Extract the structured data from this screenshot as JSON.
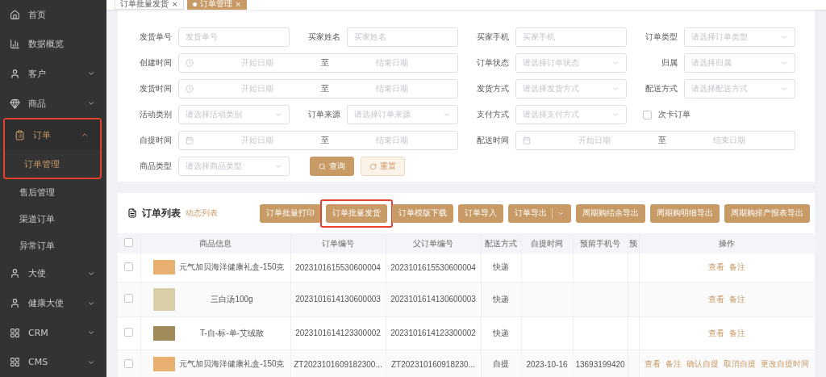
{
  "sidebar": {
    "items": [
      {
        "label": "首页",
        "expandable": false,
        "selected": false,
        "highlighted": false
      },
      {
        "label": "数据概览",
        "expandable": false,
        "selected": false,
        "highlighted": false
      },
      {
        "label": "客户",
        "expandable": true,
        "expanded": false,
        "selected": false,
        "highlighted": false
      },
      {
        "label": "商品",
        "expandable": true,
        "expanded": false,
        "selected": false,
        "highlighted": false
      },
      {
        "label": "订单",
        "expandable": true,
        "expanded": true,
        "selected": true,
        "highlighted": true,
        "children": [
          {
            "label": "订单管理",
            "selected": true,
            "highlighted": true
          },
          {
            "label": "售后管理",
            "selected": false,
            "highlighted": false
          },
          {
            "label": "渠道订单",
            "selected": false,
            "highlighted": false
          },
          {
            "label": "异常订单",
            "selected": false,
            "highlighted": false
          }
        ]
      },
      {
        "label": "大使",
        "expandable": true,
        "expanded": false,
        "selected": false,
        "highlighted": false
      },
      {
        "label": "健康大使",
        "expandable": true,
        "expanded": false,
        "selected": false,
        "highlighted": false
      },
      {
        "label": "CRM",
        "expandable": true,
        "expanded": false,
        "selected": false,
        "highlighted": false
      },
      {
        "label": "CMS",
        "expandable": true,
        "expanded": false,
        "selected": false,
        "highlighted": false
      }
    ]
  },
  "tabs": [
    {
      "label": "订单批量发货",
      "close": "×",
      "selected": false
    },
    {
      "label": "订单管理",
      "close": "×",
      "selected": true
    }
  ],
  "filters": {
    "rows": [
      [
        {
          "kind": "input",
          "label": "发货单号",
          "placeholder": "发货单号"
        },
        {
          "kind": "input",
          "label": "买家姓名",
          "placeholder": "买家姓名"
        },
        {
          "kind": "input",
          "label": "买家手机",
          "placeholder": "买家手机"
        },
        {
          "kind": "select",
          "label": "订单类型",
          "placeholder": "请选择订单类型"
        }
      ],
      [
        {
          "kind": "daterange",
          "label": "创建时间",
          "start": "开始日期",
          "separator": "至",
          "end": "结束日期"
        },
        {
          "kind": "select",
          "label": "订单状态",
          "placeholder": "请选择订单状态"
        },
        {
          "kind": "select",
          "label": "归属",
          "placeholder": "请选择归属"
        }
      ],
      [
        {
          "kind": "daterange",
          "label": "发货时间",
          "start": "开始日期",
          "separator": "至",
          "end": "结束日期"
        },
        {
          "kind": "select",
          "label": "发货方式",
          "placeholder": "请选择发货方式"
        },
        {
          "kind": "select",
          "label": "配送方式",
          "placeholder": "请选择配送方式"
        }
      ],
      [
        {
          "kind": "select",
          "label": "活动类别",
          "placeholder": "请选择活动类别"
        },
        {
          "kind": "select",
          "label": "订单来源",
          "placeholder": "请选择订单来源"
        },
        {
          "kind": "select",
          "label": "支付方式",
          "placeholder": "请选择支付方式"
        },
        {
          "kind": "checkbox",
          "label": "次卡订单",
          "checked": false
        }
      ],
      [
        {
          "kind": "daterange",
          "label": "自提时间",
          "start": "开始日期",
          "separator": "至",
          "end": "结束日期"
        },
        {
          "kind": "daterange",
          "label": "配送时间",
          "start": "开始日期",
          "separator": "至",
          "end": "结束日期"
        }
      ],
      [
        {
          "kind": "select",
          "label": "商品类型",
          "placeholder": "请选择商品类型"
        },
        {
          "kind": "buttons",
          "buttons": [
            {
              "label": "查询",
              "primary": true
            },
            {
              "label": "重置",
              "primary": false
            }
          ]
        }
      ]
    ]
  },
  "orders": {
    "title": "订单列表",
    "subtitle": "动态列表",
    "actions": [
      {
        "label": "订单批量打印",
        "dropdown": false,
        "highlighted": false
      },
      {
        "label": "订单批量发货",
        "dropdown": false,
        "highlighted": true
      },
      {
        "label": "订单模版下载",
        "dropdown": false,
        "highlighted": false
      },
      {
        "label": "订单导入",
        "dropdown": false,
        "highlighted": false
      },
      {
        "label": "订单导出",
        "dropdown": true,
        "highlighted": false
      },
      {
        "label": "周期购结余导出",
        "dropdown": false,
        "highlighted": false
      },
      {
        "label": "周期购明细导出",
        "dropdown": false,
        "highlighted": false
      },
      {
        "label": "周期购排产报表导出",
        "dropdown": false,
        "highlighted": false
      }
    ],
    "select_all": {
      "checked": false
    },
    "columns": [
      "商品信息",
      "订单编号",
      "父订单编号",
      "配送方式",
      "自提时间",
      "预留手机号",
      "预",
      "操作"
    ],
    "rows": [
      {
        "checked": false,
        "cells": [
          "元气加贝海洋健康礼盒-150克",
          "2023101615530600004",
          "2023101615530600004",
          "快递",
          "",
          ""
        ],
        "operations": [
          "查看",
          "备注"
        ]
      },
      {
        "checked": false,
        "cells": [
          "三白汤100g",
          "2023101614130600003",
          "2023101614130600003",
          "快递",
          "",
          ""
        ],
        "operations": [
          "查看",
          "备注"
        ]
      },
      {
        "checked": false,
        "cells": [
          "T-自-标-单-艾绒散",
          "2023101614123300002",
          "2023101614123300002",
          "快递",
          "",
          ""
        ],
        "operations": [
          "查看",
          "备注"
        ]
      },
      {
        "checked": false,
        "cells": [
          "元气加贝海洋健康礼盒-150克",
          "ZT2023101609182300...",
          "ZT202310160918230...",
          "自提",
          "2023-10-16",
          "13693199420"
        ],
        "operations": [
          "查看",
          "备注",
          "确认自提",
          "取消自提",
          "更改自提时间"
        ]
      }
    ]
  }
}
